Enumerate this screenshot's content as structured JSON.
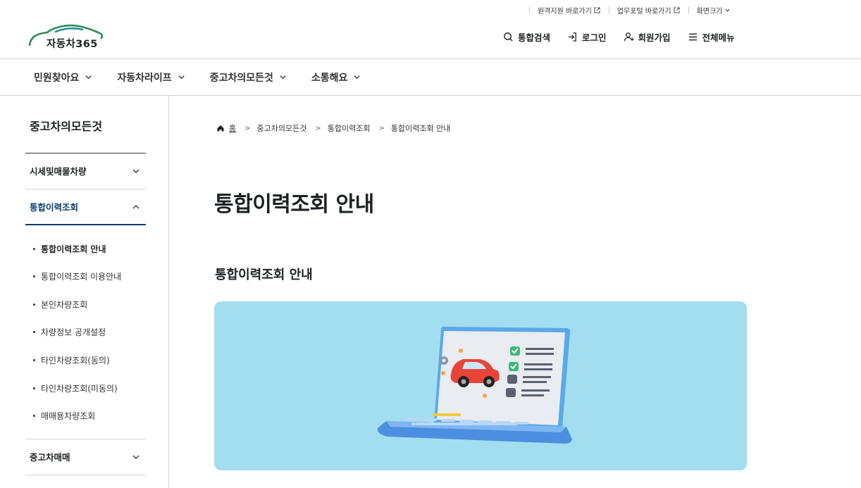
{
  "utility": {
    "remote_support": "원격지원 바로가기",
    "work_portal": "업무포털 바로가기",
    "screen_size": "화면크기"
  },
  "header": {
    "logo_text": "자동차365",
    "search": "통합검색",
    "login": "로그인",
    "signup": "회원가입",
    "all_menu": "전체메뉴"
  },
  "nav": {
    "items": [
      "민원찾아요",
      "자동차라이프",
      "중고차의모든것",
      "소통해요"
    ]
  },
  "sidebar": {
    "title": "중고차의모든것",
    "groups": [
      "시세및매물차량",
      "통합이력조회",
      "중고차매매"
    ],
    "sub_items": [
      "통합이력조회 안내",
      "통합이력조회 이용안내",
      "본인차량조회",
      "차량정보 공개설정",
      "타인차량조회(동의)",
      "타인차량조회(미동의)",
      "매매용차량조회"
    ]
  },
  "breadcrumb": [
    "홈",
    "중고차의모든것",
    "통합이력조회",
    "통합이력조회 안내"
  ],
  "content": {
    "page_title": "통합이력조회 안내",
    "section_title": "통합이력조회 안내"
  },
  "colors": {
    "brand_navy": "#0b3c71",
    "banner_bg": "#a2def0",
    "logo_green": "#2e8b57",
    "logo_teal": "#2b8c9a"
  }
}
